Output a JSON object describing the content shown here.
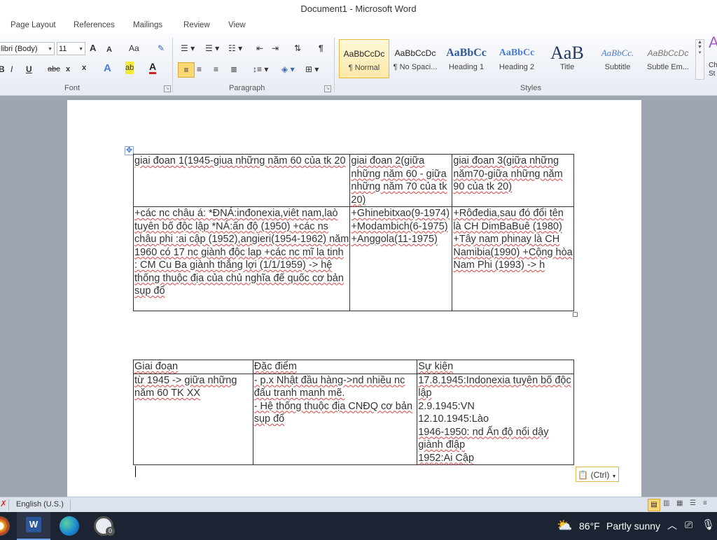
{
  "window": {
    "title": "Document1  -  Microsoft Word"
  },
  "ribbon_tabs": [
    "Page Layout",
    "References",
    "Mailings",
    "Review",
    "View"
  ],
  "font_group": {
    "label": "Font",
    "font_name": "libri (Body)",
    "font_size": "11",
    "grow": "A",
    "shrink": "A",
    "change_case": "Aa",
    "bold": "B",
    "italic": "I",
    "underline": "U",
    "strike": "abc",
    "subscript": "x",
    "superscript": "x",
    "text_effects": "A",
    "highlight": "ab",
    "font_color": "A"
  },
  "paragraph_group": {
    "label": "Paragraph",
    "pilcrow": "¶"
  },
  "styles_group": {
    "label": "Styles",
    "items": [
      {
        "preview": "AaBbCcDc",
        "name": "¶ Normal"
      },
      {
        "preview": "AaBbCcDc",
        "name": "¶ No Spaci..."
      },
      {
        "preview": "AaBbCc",
        "name": "Heading 1"
      },
      {
        "preview": "AaBbCc",
        "name": "Heading 2"
      },
      {
        "preview": "AaB",
        "name": "Title"
      },
      {
        "preview": "AaBbCc.",
        "name": "Subtitle"
      },
      {
        "preview": "AaBbCcDc",
        "name": "Subtle Em..."
      }
    ],
    "change_styles_preview": "A",
    "change_styles_label": "Ch St"
  },
  "table1": {
    "rows": [
      [
        "giai đoan 1(1945-giua những năm 60 của tk 20",
        "giai đoan 2(giữa những năm 60 - giữa những năm 70 của tk 20)",
        "giai đoan 3(giữa những năm70-giữa những năm 90 của tk 20)"
      ],
      [
        "+các nc châu á: *ĐNÁ:inđonexia,viêt nam,laò tuyên bố độc lập *NÁ:ấn độ (1950) +các ns châu phi :ai cập (1952),angieri(1954-1962) năm 1960 có 17 nc giành độc lap +các nc mĩ la tinh : CM Cu Ba giành thắng lợi (1/1/1959) -> hệ thống thuộc địa của chủ nghĩa đế quốc cơ bản sụp đổ",
        "+Ghinebitxao(9-1974) +Modambich(6-1975) +Anggola(11-1975)",
        "+Rôđedia,sau đó đổi tên là CH DimBaBuê (1980) +Tây nam phinay là CH Namibia(1990) +Cộng hòa Nam Phi (1993) -> h"
      ]
    ]
  },
  "table2": {
    "headers": [
      "Giai đoạn",
      "Đặc điểm",
      "Sự kiện"
    ],
    "row": [
      "từ 1945 -> giữa những năm 60 TK XX",
      "- p.x Nhật đầu hàng->nd nhiều nc đấu tranh manh mẽ.",
      "- Hệ thống thuộc địa CNĐQ cơ bản sụp đổ",
      "17.8.1945:Indonexia tuyên bố độc lập",
      "2.9.1945:VN",
      "12.10.1945:Lào",
      "1946-1950: nd Ấn độ nổi dậy giành đlập",
      "1952:Ai Cập"
    ]
  },
  "paste_options": {
    "label": "(Ctrl)"
  },
  "status": {
    "language": "English (U.S.)"
  },
  "taskbar": {
    "temperature": "86°F",
    "weather": "Partly sunny",
    "badge": "0"
  },
  "colors": {
    "ribbon_bg": "#e6ebf3",
    "selected_style": "#fde8a8",
    "taskbar": "#1c2333",
    "spell_error": "#e04040"
  }
}
